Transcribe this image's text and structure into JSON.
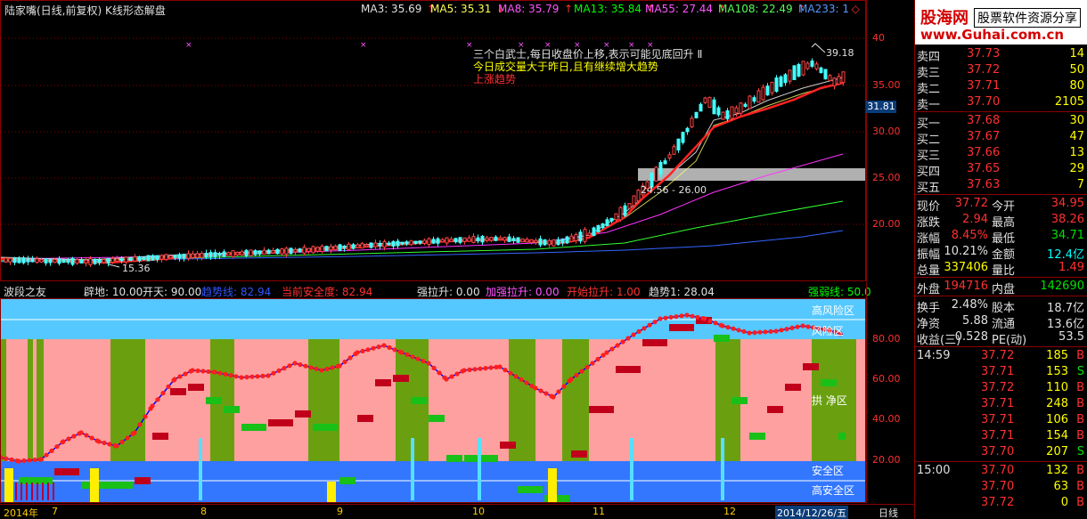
{
  "top_header": {
    "title": "陆家嘴(日线,前复权) K线形态解盘",
    "ma": [
      {
        "text": "MA3: 35.69",
        "arrow": "↑",
        "color": "#e0e0e0"
      },
      {
        "text": "MA5: 35.31",
        "arrow": "↓",
        "color": "#ffff55"
      },
      {
        "text": "MA8: 35.79",
        "arrow": "↑",
        "color": "#ff55ff"
      },
      {
        "text": "MA13: 35.84",
        "arrow": "↑",
        "color": "#00ff00"
      },
      {
        "text": "MA55: 27.44",
        "arrow": "↑",
        "color": "#ff55ff"
      },
      {
        "text": "MA108: 22.49",
        "arrow": "↑",
        "color": "#55ff55"
      },
      {
        "text": "MA233: 1",
        "arrow": "◇",
        "color": "#5599ff"
      }
    ]
  },
  "annotations": {
    "line1": "三个白武士,每日收盘价上移,表示可能见底回升 Ⅱ",
    "line2": "今日成交量大于昨日,且有继续增大趋势",
    "line3": "上涨趋势",
    "high_label": "39.18",
    "low_label": "15.36",
    "gap_label": "24.56 - 26.00",
    "price_box": "31.81"
  },
  "top_axis": [
    "40",
    "35.00",
    "30.00",
    "25.00",
    "20.00"
  ],
  "bottom_header": {
    "name": "波段之友",
    "items": [
      {
        "text": "辟地: 10.00",
        "color": "#e0e0e0"
      },
      {
        "text": "开天: 90.00",
        "color": "#e0e0e0"
      },
      {
        "text": "趋势线: 82.94",
        "color": "#3355ff"
      },
      {
        "text": "当前安全度: 82.94",
        "color": "#ff3030"
      },
      {
        "text": "强拉升: 0.00",
        "color": "#e0e0e0"
      },
      {
        "text": "加强拉升: 0.00",
        "color": "#ff55ff"
      },
      {
        "text": "开始拉升: 1.00",
        "color": "#ff3030"
      },
      {
        "text": "趋势1: 28.04",
        "color": "#e0e0e0"
      },
      {
        "text": "强弱线: 50.0",
        "color": "#00ff00"
      }
    ]
  },
  "zones": {
    "high_risk": "高风险区",
    "risk": "风险区",
    "mid": "拱 净区",
    "safe": "安全区",
    "high_safe": "高安全区"
  },
  "bottom_axis": [
    "80.00",
    "60.00",
    "40.00",
    "20.00"
  ],
  "dates": [
    {
      "text": "2014年"
    },
    {
      "text": "7"
    },
    {
      "text": "8"
    },
    {
      "text": "9"
    },
    {
      "text": "10"
    },
    {
      "text": "11"
    },
    {
      "text": "12"
    },
    {
      "text": "2014/12/26/五"
    },
    {
      "text": "日线"
    }
  ],
  "quote": {
    "logo_name": "股海网",
    "logo_slogan": "股票软件资源分享",
    "logo_url": "www.Guhai.com.cn",
    "asks": [
      {
        "label": "卖四",
        "price": "37.73",
        "vol": "14"
      },
      {
        "label": "卖三",
        "price": "37.72",
        "vol": "50"
      },
      {
        "label": "卖二",
        "price": "37.71",
        "vol": "80"
      },
      {
        "label": "卖一",
        "price": "37.70",
        "vol": "2105"
      }
    ],
    "bids": [
      {
        "label": "买一",
        "price": "37.68",
        "vol": "30"
      },
      {
        "label": "买二",
        "price": "37.67",
        "vol": "47"
      },
      {
        "label": "买三",
        "price": "37.66",
        "vol": "13"
      },
      {
        "label": "买四",
        "price": "37.65",
        "vol": "29"
      },
      {
        "label": "买五",
        "price": "37.63",
        "vol": "7"
      }
    ],
    "stats": [
      {
        "l1": "现价",
        "v1": "37.72",
        "c1": "red",
        "l2": "今开",
        "v2": "34.95",
        "c2": "red"
      },
      {
        "l1": "涨跌",
        "v1": "2.94",
        "c1": "red",
        "l2": "最高",
        "v2": "38.26",
        "c2": "red"
      },
      {
        "l1": "涨幅",
        "v1": "8.45%",
        "c1": "red",
        "l2": "最低",
        "v2": "34.71",
        "c2": "grn"
      },
      {
        "l1": "振幅",
        "v1": "10.21%",
        "c1": "wht",
        "l2": "金额",
        "v2": "12.4亿",
        "c2": "cyn"
      },
      {
        "l1": "总量",
        "v1": "337406",
        "c1": "yel",
        "l2": "量比",
        "v2": "1.49",
        "c2": "red"
      }
    ],
    "outer": {
      "l1": "外盘",
      "v1": "194716",
      "l2": "内盘",
      "v2": "142690"
    },
    "stats2": [
      {
        "l1": "换手",
        "v1": "2.48%",
        "l2": "股本",
        "v2": "18.7亿"
      },
      {
        "l1": "净资",
        "v1": "5.88",
        "l2": "流通",
        "v2": "13.6亿"
      },
      {
        "l1": "收益(三)",
        "v1": "0.528",
        "l2": "PE(动)",
        "v2": "53.5"
      }
    ],
    "ticks": [
      {
        "time": "14:59",
        "price": "37.72",
        "vol": "185",
        "bs": "B"
      },
      {
        "time": "",
        "price": "37.71",
        "vol": "153",
        "bs": "S"
      },
      {
        "time": "",
        "price": "37.72",
        "vol": "110",
        "bs": "B"
      },
      {
        "time": "",
        "price": "37.71",
        "vol": "248",
        "bs": "B"
      },
      {
        "time": "",
        "price": "37.71",
        "vol": "106",
        "bs": "B"
      },
      {
        "time": "",
        "price": "37.71",
        "vol": "154",
        "bs": "B"
      },
      {
        "time": "",
        "price": "37.70",
        "vol": "207",
        "bs": "S"
      }
    ],
    "ticks2": [
      {
        "time": "15:00",
        "price": "37.70",
        "vol": "132",
        "bs": "B"
      },
      {
        "time": "",
        "price": "37.70",
        "vol": "63",
        "bs": "B"
      },
      {
        "time": "",
        "price": "37.72",
        "vol": "0",
        "bs": "B"
      }
    ]
  }
}
